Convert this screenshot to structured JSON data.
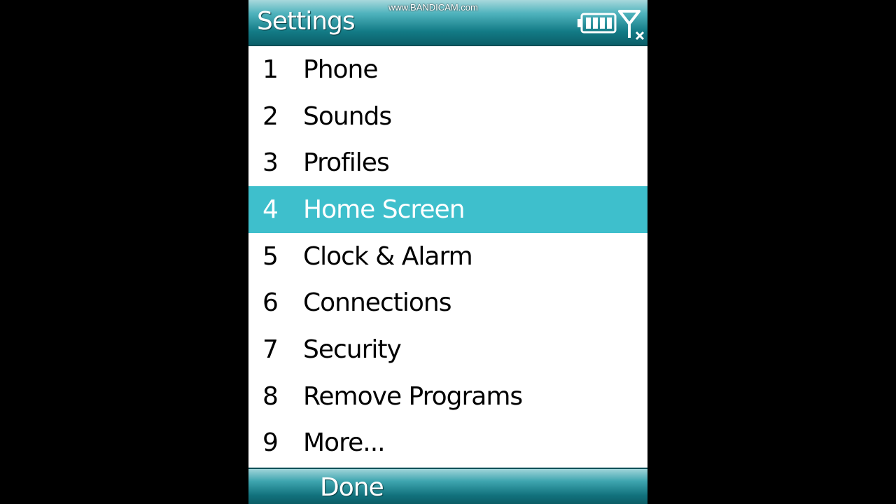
{
  "watermark": "www.BANDICAM.com",
  "header": {
    "title": "Settings",
    "icons": [
      "battery-icon",
      "signal-icon"
    ]
  },
  "menu": {
    "items": [
      {
        "num": "1",
        "label": "Phone"
      },
      {
        "num": "2",
        "label": "Sounds"
      },
      {
        "num": "3",
        "label": "Profiles"
      },
      {
        "num": "4",
        "label": "Home Screen",
        "selected": true
      },
      {
        "num": "5",
        "label": "Clock & Alarm"
      },
      {
        "num": "6",
        "label": "Connections"
      },
      {
        "num": "7",
        "label": "Security"
      },
      {
        "num": "8",
        "label": "Remove Programs"
      },
      {
        "num": "9",
        "label": "More..."
      }
    ]
  },
  "softkeys": {
    "left": "Done"
  },
  "colors": {
    "selection": "#3ebfcc",
    "titlebar": "#137b86"
  }
}
